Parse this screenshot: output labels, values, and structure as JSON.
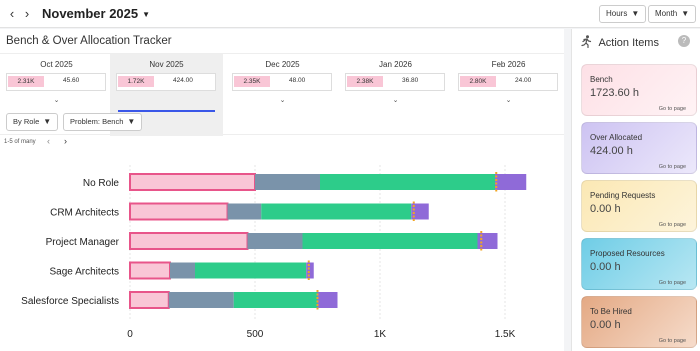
{
  "header": {
    "prev_icon": "chevron-left-icon",
    "next_icon": "chevron-right-icon",
    "title": "November 2025",
    "hours_select": "Hours",
    "period_select": "Month"
  },
  "main": {
    "title": "Bench & Over Allocation Tracker",
    "months": [
      {
        "name": "Oct 2025",
        "bench": "2.31K",
        "over": "45.60"
      },
      {
        "name": "Nov 2025",
        "bench": "1.72K",
        "over": "424.00"
      },
      {
        "name": "Dec 2025",
        "bench": "2.35K",
        "over": "48.00"
      },
      {
        "name": "Jan 2026",
        "bench": "2.38K",
        "over": "36.80"
      },
      {
        "name": "Feb 2026",
        "bench": "2.80K",
        "over": "24.00"
      }
    ],
    "filter_group": "By Role",
    "filter_problem": "Problem: Bench",
    "pager": "1-5 of many"
  },
  "chart_data": {
    "type": "bar",
    "orientation": "horizontal",
    "stacked": true,
    "categories": [
      "No Role",
      "CRM Architects",
      "Project Manager",
      "Sage Architects",
      "Salesforce Specialists"
    ],
    "series": [
      {
        "color": "#f9c6d6",
        "values": [
          500,
          390,
          470,
          160,
          155
        ]
      },
      {
        "color": "#7a93aa",
        "values": [
          260,
          135,
          220,
          100,
          260
        ]
      },
      {
        "color": "#2dcc8a",
        "values": [
          700,
          600,
          700,
          445,
          335
        ]
      },
      {
        "color": "#8f6ad8",
        "values": [
          125,
          70,
          80,
          30,
          80
        ]
      }
    ],
    "threshold_marker": [
      1465,
      1135,
      1405,
      715,
      750
    ],
    "xlim": [
      0,
      1600
    ],
    "xticks": [
      "0",
      "500",
      "1K",
      "1.5K"
    ],
    "xtick_values": [
      0,
      500,
      1000,
      1500
    ]
  },
  "sidebar": {
    "title": "Action Items",
    "title_icon": "person-running-icon",
    "help_icon": "help-icon",
    "cards": [
      {
        "title": "Bench",
        "value": "1723.60 h",
        "link": "Go to page",
        "color": "#fde0e6"
      },
      {
        "title": "Over Allocated",
        "value": "424.00 h",
        "link": "Go to page",
        "color": "#cdc3f2"
      },
      {
        "title": "Pending Requests",
        "value": "0.00 h",
        "link": "Go to page",
        "color": "#fbe8b4"
      },
      {
        "title": "Proposed Resources",
        "value": "0.00 h",
        "link": "Go to page",
        "color": "#7fd3e8"
      },
      {
        "title": "To Be Hired",
        "value": "0.00 h",
        "link": "Go to page",
        "color": "#e9b595"
      }
    ]
  }
}
